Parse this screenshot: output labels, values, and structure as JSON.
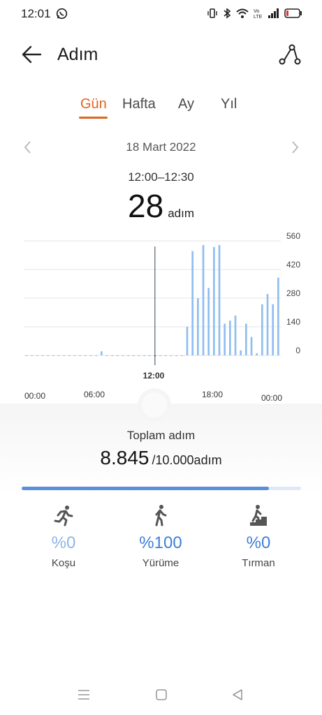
{
  "status_bar": {
    "time": "12:01",
    "battery_color": "#d33"
  },
  "header": {
    "title": "Adım"
  },
  "tabs": [
    {
      "label": "Gün",
      "selected": true
    },
    {
      "label": "Hafta",
      "selected": false
    },
    {
      "label": "Ay",
      "selected": false
    },
    {
      "label": "Yıl",
      "selected": false
    }
  ],
  "date": {
    "label": "18 Mart 2022"
  },
  "selection": {
    "range": "12:00–12:30",
    "steps": "28",
    "unit": "adım"
  },
  "chart_data": {
    "type": "bar",
    "x_tick_labels": [
      "00:00",
      "06:00",
      "12:00",
      "18:00",
      "00:00"
    ],
    "y_tick_labels": [
      "560",
      "420",
      "280",
      "140",
      "0"
    ],
    "ylim": [
      0,
      560
    ],
    "bar_color": "#8fbef0",
    "selected_slot": 24,
    "values": [
      0,
      0,
      0,
      0,
      0,
      0,
      0,
      0,
      0,
      0,
      0,
      0,
      0,
      0,
      20,
      0,
      0,
      0,
      0,
      0,
      0,
      0,
      0,
      0,
      0,
      0,
      0,
      0,
      0,
      0,
      140,
      510,
      280,
      540,
      330,
      530,
      540,
      155,
      170,
      195,
      25,
      155,
      90,
      10,
      250,
      300,
      250,
      380,
      225,
      285,
      290,
      420,
      105,
      310,
      45,
      230,
      540,
      185,
      270,
      220,
      420,
      40,
      45,
      55
    ],
    "start_slot": 0
  },
  "summary": {
    "total_label": "Toplam adım",
    "total_value": "8.845",
    "goal": "/10.000adım",
    "progress": 0.8845
  },
  "activities": [
    {
      "name": "run",
      "pct": "%0",
      "label": "Koşu"
    },
    {
      "name": "walk",
      "pct": "%100",
      "label": "Yürüme"
    },
    {
      "name": "climb",
      "pct": "%0",
      "label": "Tırman"
    }
  ]
}
